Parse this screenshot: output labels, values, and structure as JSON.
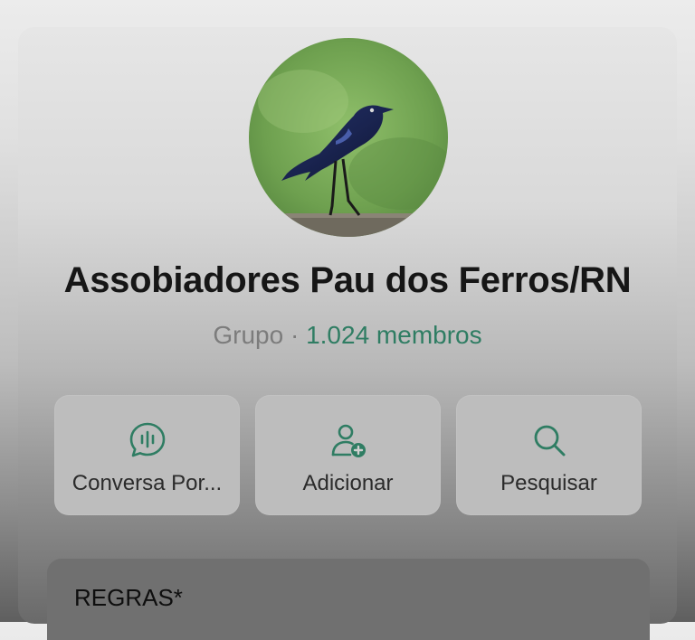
{
  "group": {
    "name": "Assobiadores Pau dos Ferros/RN",
    "type": "Grupo",
    "separator": "·",
    "members": "1.024 membros"
  },
  "actions": [
    {
      "label": "Conversa Por...",
      "icon": "voice-chat-icon"
    },
    {
      "label": "Adicionar",
      "icon": "add-person-icon"
    },
    {
      "label": "Pesquisar",
      "icon": "search-icon"
    }
  ],
  "rules": {
    "title": "REGRAS*"
  },
  "colors": {
    "accent": "#2f7d63",
    "icon": "#2f7d63",
    "text_dark": "#161616",
    "text_muted": "#7c7c7c"
  }
}
